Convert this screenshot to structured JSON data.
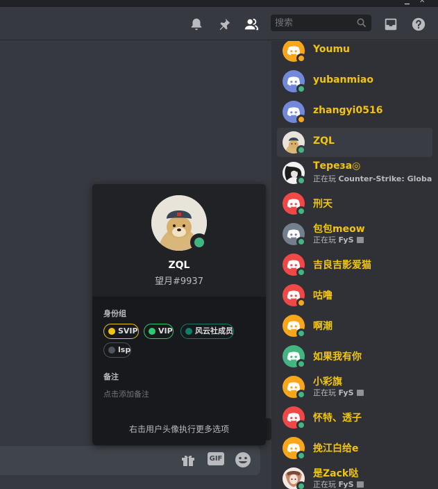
{
  "header": {
    "search_placeholder": "搜索",
    "icons": [
      "bell-icon",
      "pin-icon",
      "members-icon",
      "search-icon",
      "inbox-icon",
      "help-icon"
    ]
  },
  "composer": {
    "icons": [
      "gift-icon",
      "gif-icon",
      "emoji-icon"
    ],
    "gif_label": "GIF"
  },
  "members": [
    {
      "name": "Youmu",
      "status": "idle",
      "avatar_color": "#faa61a",
      "activity": null
    },
    {
      "name": "yubanmiao",
      "status": "online",
      "avatar_color": "#7289da",
      "activity": null
    },
    {
      "name": "zhangyi0516",
      "status": "idle",
      "avatar_color": "#7289da",
      "activity": null
    },
    {
      "name": "ZQL",
      "status": "online",
      "avatar_color": "photo",
      "activity": null,
      "selected": true
    },
    {
      "name": "Тереза◎",
      "status": "online",
      "avatar_color": "photo-dark",
      "activity": {
        "prefix": "正在玩 ",
        "game": "Counter-Strike: Global ..."
      }
    },
    {
      "name": "刑天",
      "status": "online",
      "avatar_color": "#f04747",
      "activity": null
    },
    {
      "name": "包包meow",
      "status": "online",
      "avatar_color": "#747f8d",
      "activity": {
        "prefix": "正在玩 ",
        "game": "FyS"
      }
    },
    {
      "name": "吉良吉影爱猫",
      "status": "online",
      "avatar_color": "#f04747",
      "activity": null
    },
    {
      "name": "咕噜",
      "status": "idle",
      "avatar_color": "#f04747",
      "activity": null
    },
    {
      "name": "啊潮",
      "status": "online",
      "avatar_color": "#faa61a",
      "activity": null
    },
    {
      "name": "如果我有你",
      "status": "online",
      "avatar_color": "#43b581",
      "activity": null
    },
    {
      "name": "小彩旗",
      "status": "online",
      "avatar_color": "#faa61a",
      "activity": {
        "prefix": "正在玩 ",
        "game": "FyS"
      }
    },
    {
      "name": "怀特、透子",
      "status": "online",
      "avatar_color": "#f04747",
      "activity": null
    },
    {
      "name": "挽江白给e",
      "status": "online",
      "avatar_color": "#faa61a",
      "activity": null
    },
    {
      "name": "是Zack哒",
      "status": "online",
      "avatar_color": "photo-pink",
      "activity": {
        "prefix": "正在玩 ",
        "game": "FyS"
      }
    }
  ],
  "profile": {
    "name": "ZQL",
    "tag": "望月#9937",
    "roles_title": "身份组",
    "roles": [
      {
        "label": "SVIP",
        "color": "#f1c40f"
      },
      {
        "label": "VIP",
        "color": "#2ecc71"
      },
      {
        "label": "风云社成员",
        "color": "#11806a"
      },
      {
        "label": "lsp",
        "color": "#4f545c"
      }
    ],
    "note_title": "备注",
    "note_placeholder": "点击添加备注",
    "hint": "右击用户头像执行更多选项"
  },
  "colors": {
    "username": "#f1c40f",
    "online": "#43b581",
    "idle": "#faa61a"
  }
}
